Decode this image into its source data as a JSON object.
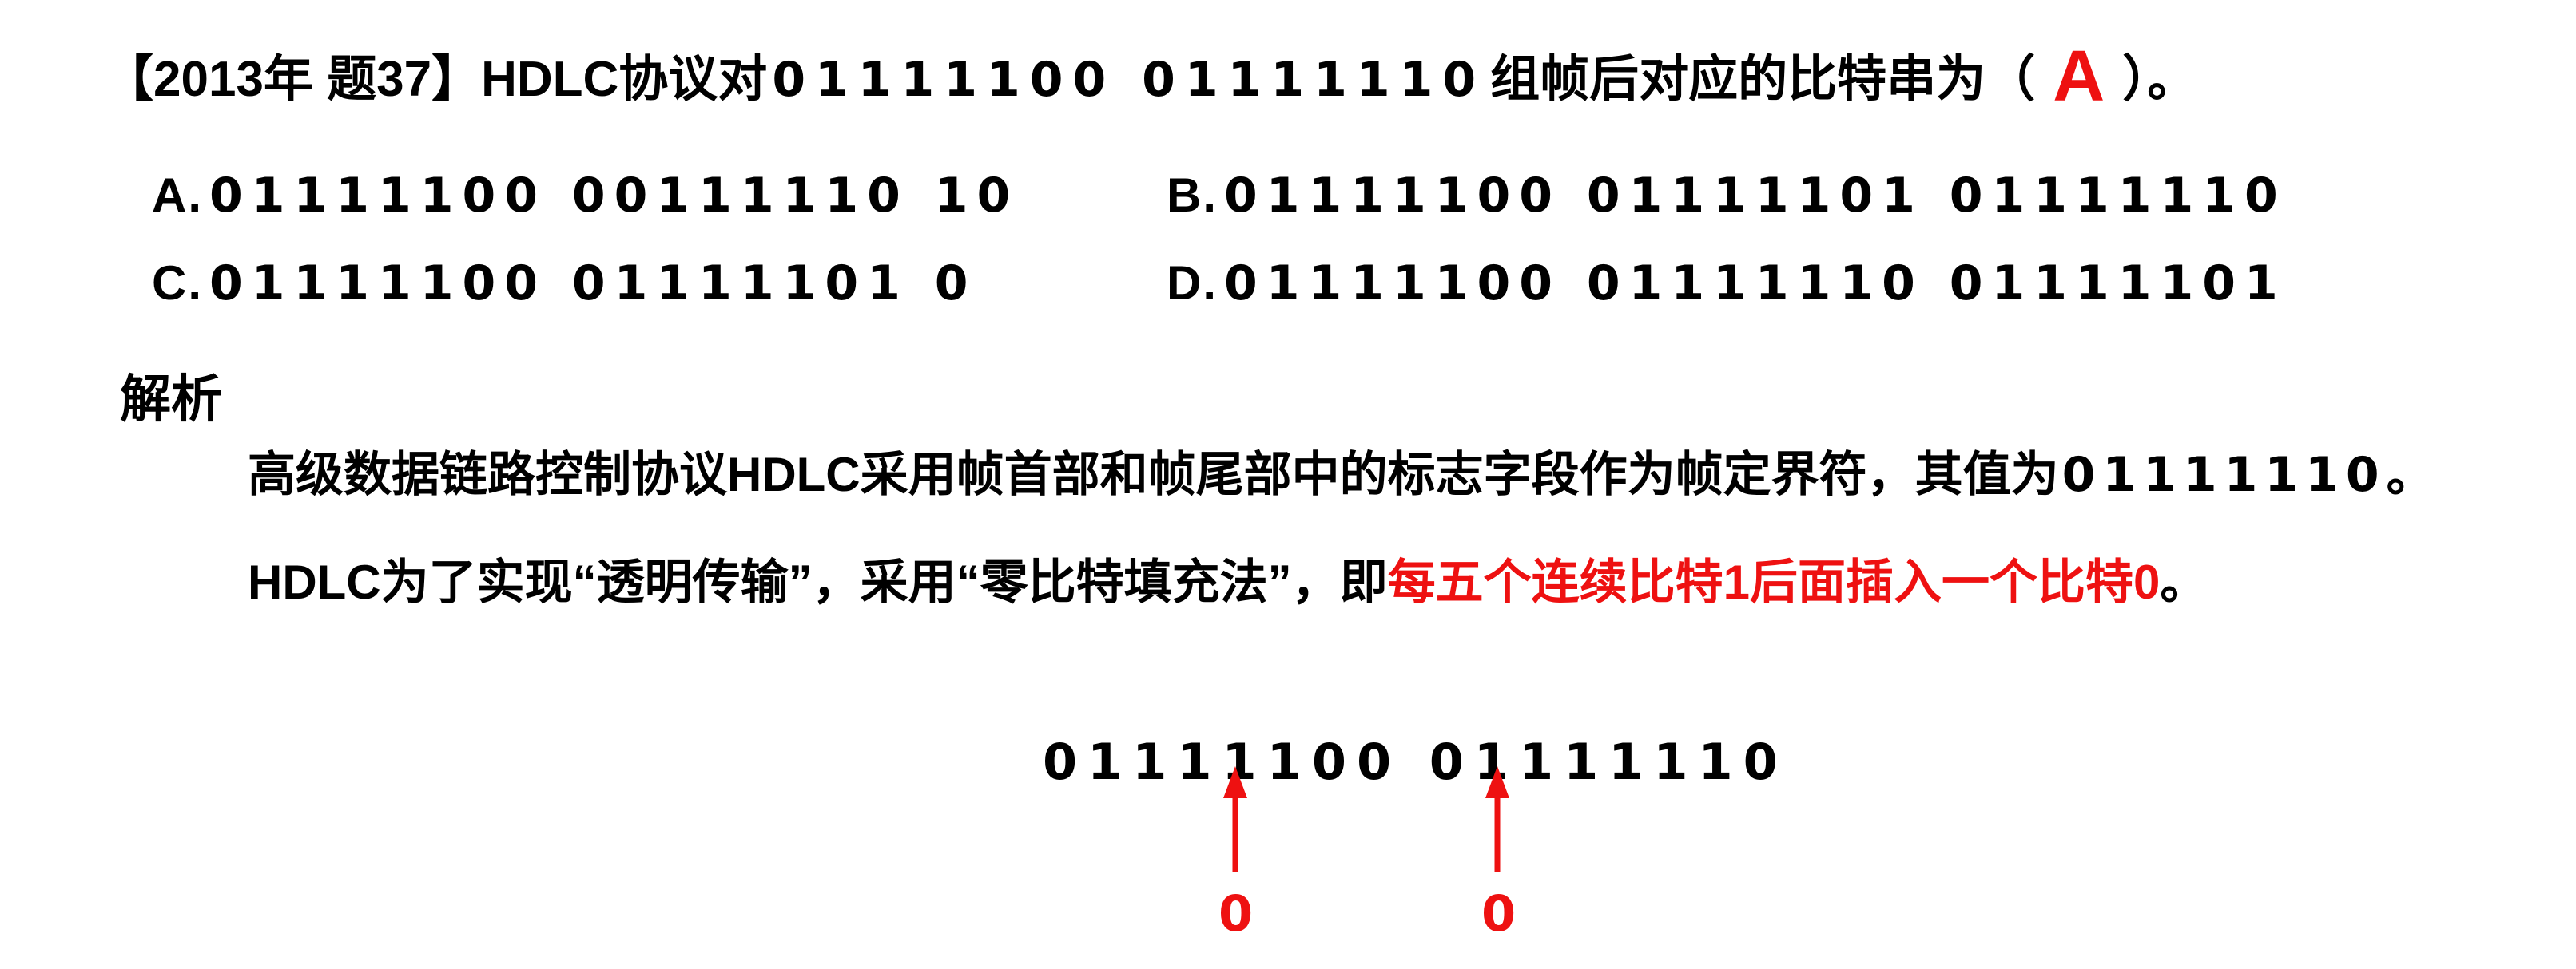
{
  "question": {
    "prefix": "【2013年 题37】HDLC协议对",
    "bits": "01111100 01111110",
    "suffix_before_answer": "组帧后对应的比特串为（",
    "answer": "A",
    "suffix_after_answer": "）。"
  },
  "options": [
    {
      "label": "A.",
      "bits": "01111100 00111110 10"
    },
    {
      "label": "B.",
      "bits": "01111100 01111101 01111110"
    },
    {
      "label": "C.",
      "bits": "01111100 01111101 0"
    },
    {
      "label": "D.",
      "bits": "01111100 01111110 01111101"
    }
  ],
  "analysis": {
    "heading": "解析",
    "para1_text": "高级数据链路控制协议HDLC采用帧首部和帧尾部中的标志字段作为帧定界符，其值为",
    "para1_bits": "01111110",
    "para1_end": "。",
    "para2_text": "HDLC为了实现“透明传输”，采用“零比特填充法”，即",
    "para2_highlight": "每五个连续比特1后面插入一个比特0",
    "para2_end": "。"
  },
  "diagram": {
    "bits": "01111100 01111110",
    "inserted_labels": [
      "0",
      "0"
    ],
    "accent_color": "#ee1111"
  }
}
